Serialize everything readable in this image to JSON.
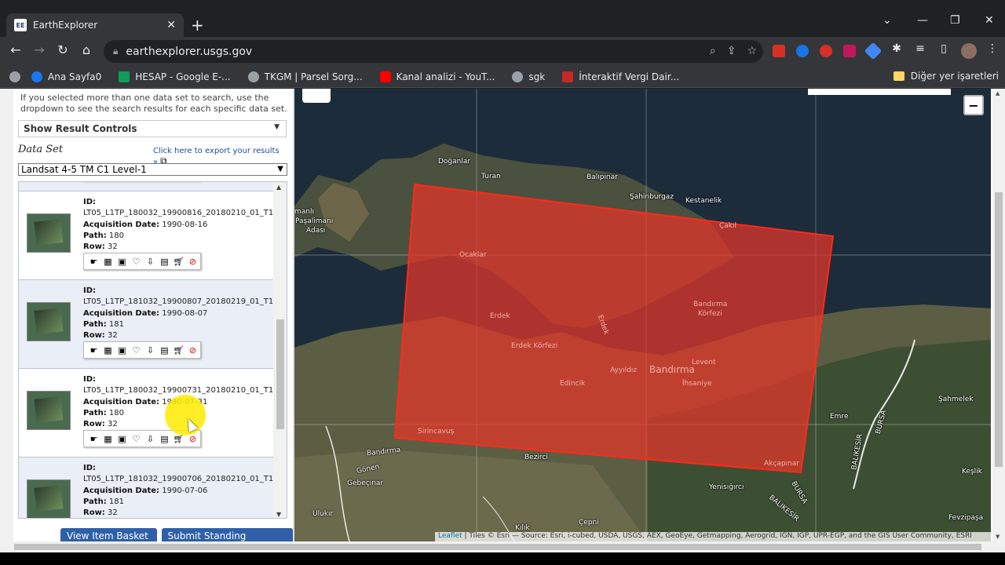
{
  "browser": {
    "tab_title": "EarthExplorer",
    "tab_favicon_text": "EE",
    "url": "earthexplorer.usgs.gov",
    "bookmarks": [
      {
        "label": "Ana Sayfa0",
        "icon": "facebook-icon",
        "color": "#1877f2"
      },
      {
        "label": "HESAP - Google E-...",
        "icon": "sheets-icon",
        "color": "#0f9d58"
      },
      {
        "label": "TKGM | Parsel Sorg...",
        "icon": "globe-icon",
        "color": "#9aa0a6"
      },
      {
        "label": "Kanal analizi - YouT...",
        "icon": "youtube-icon",
        "color": "#ff0000"
      },
      {
        "label": "sgk",
        "icon": "globe-icon",
        "color": "#9aa0a6"
      },
      {
        "label": "İnteraktif Vergi Dair...",
        "icon": "gib-icon",
        "color": "#c62828"
      }
    ],
    "other_bookmarks": "Diğer yer işaretleri"
  },
  "panel": {
    "info_text": "If you selected more than one data set to search, use the dropdown to see the search results for each specific data set.",
    "result_controls": "Show Result Controls",
    "dataset_label": "Data Set",
    "export_link": "Click here to export your results »",
    "dataset_selected": "Landsat 4-5 TM C1 Level-1",
    "results": [
      {
        "id_label": "ID:",
        "id": "LT05_L1TP_180032_19900816_20180210_01_T1",
        "date_label": "Acquisition Date:",
        "date": "1990-08-16",
        "path_label": "Path:",
        "path": "180",
        "row_label": "Row:",
        "row": "32"
      },
      {
        "id_label": "ID:",
        "id": "LT05_L1TP_181032_19900807_20180219_01_T1",
        "date_label": "Acquisition Date:",
        "date": "1990-08-07",
        "path_label": "Path:",
        "path": "181",
        "row_label": "Row:",
        "row": "32"
      },
      {
        "id_label": "ID:",
        "id": "LT05_L1TP_180032_19900731_20180210_01_T1",
        "date_label": "Acquisition Date:",
        "date": "1990-07-31",
        "path_label": "Path:",
        "path": "180",
        "row_label": "Row:",
        "row": "32"
      },
      {
        "id_label": "ID:",
        "id": "LT05_L1TP_181032_19900706_20180210_01_T1",
        "date_label": "Acquisition Date:",
        "date": "1990-07-06",
        "path_label": "Path:",
        "path": "181",
        "row_label": "Row:",
        "row": "32"
      }
    ],
    "view_basket": "View Item Basket »",
    "standing_request": "Submit Standing Request »"
  },
  "map": {
    "labels": [
      {
        "text": "Doğanlar",
        "style": "white"
      },
      {
        "text": "Turan",
        "style": "white"
      },
      {
        "text": "Balıpınar",
        "style": "white"
      },
      {
        "text": "Şahinburgaz",
        "style": "white"
      },
      {
        "text": "Kestanelik",
        "style": "white"
      },
      {
        "text": "manlı",
        "style": "white"
      },
      {
        "text": "Paşalimanı",
        "style": "white"
      },
      {
        "text": "Adası",
        "style": "white"
      },
      {
        "text": "Çakıl",
        "style": "red"
      },
      {
        "text": "Ocaklar",
        "style": "red"
      },
      {
        "text": "Bandırma",
        "style": "red"
      },
      {
        "text": "Körfezi",
        "style": "red"
      },
      {
        "text": "Erdek",
        "style": "red"
      },
      {
        "text": "Erdek",
        "style": "red"
      },
      {
        "text": "Erdek Körfezi",
        "style": "red"
      },
      {
        "text": "Ayyıldız",
        "style": "red"
      },
      {
        "text": "Bandırma",
        "style": "redbig"
      },
      {
        "text": "Levent",
        "style": "red"
      },
      {
        "text": "İhsaniye",
        "style": "red"
      },
      {
        "text": "Edincik",
        "style": "red"
      },
      {
        "text": "Sirincavuş",
        "style": "red"
      },
      {
        "text": "Bandırma",
        "style": "white"
      },
      {
        "text": "Gönen",
        "style": "white"
      },
      {
        "text": "Gebeçınar",
        "style": "white"
      },
      {
        "text": "Bezirci",
        "style": "white"
      },
      {
        "text": "Akçapınar",
        "style": "red"
      },
      {
        "text": "Emre",
        "style": "white"
      },
      {
        "text": "BURSA",
        "style": "white"
      },
      {
        "text": "BALIKESİR",
        "style": "white"
      },
      {
        "text": "Şahmelek",
        "style": "white"
      },
      {
        "text": "Keşlik",
        "style": "white"
      },
      {
        "text": "Yenisığırcı",
        "style": "white"
      },
      {
        "text": "BALIKESİR",
        "style": "white"
      },
      {
        "text": "BURSA",
        "style": "white"
      },
      {
        "text": "Fevzipaşa",
        "style": "white"
      },
      {
        "text": "Ulukır",
        "style": "white"
      },
      {
        "text": "Kılık",
        "style": "white"
      },
      {
        "text": "Çepni",
        "style": "white"
      }
    ],
    "zoom_out": "−",
    "attribution_leaflet": "Leaflet",
    "attribution_text": " | Tiles © Esri — Source: Esri, i-cubed, USDA, USGS, AEX, GeoEye, Getmapping, Aerogrid, IGN, IGP, UPR-EGP, and the GIS User Community, ESRI"
  },
  "colors": {
    "footprint_fill": "#e8352a",
    "footprint_stroke": "#ff2a1a",
    "button_blue": "#2f5fa6",
    "cursor_highlight": "#ffeb00"
  }
}
